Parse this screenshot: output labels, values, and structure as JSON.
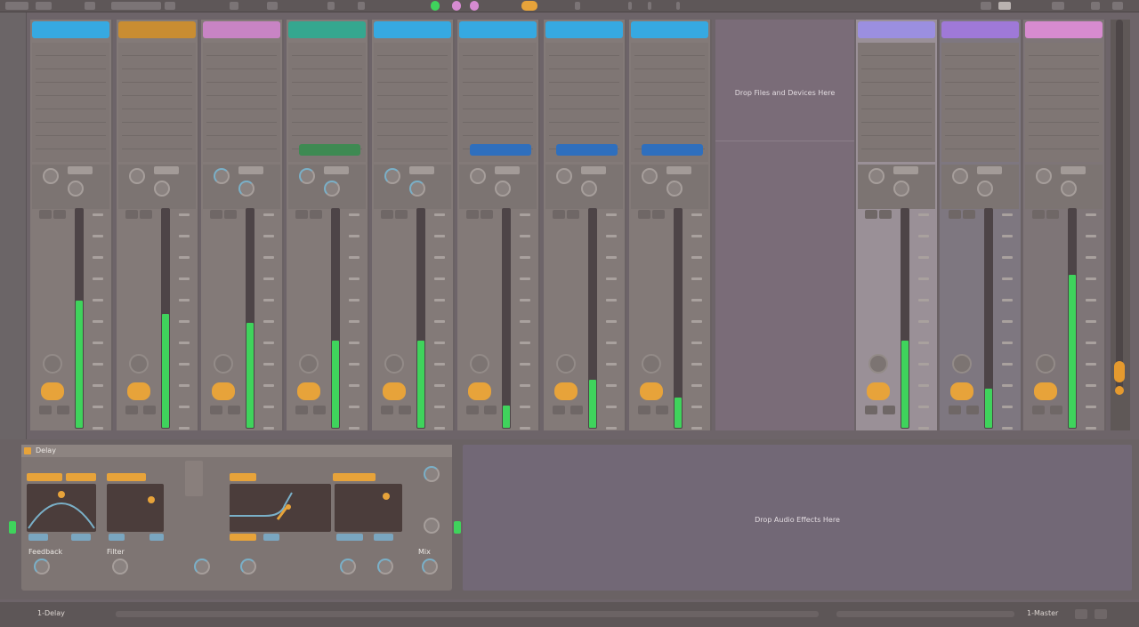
{
  "transport": {
    "record_color": "#3fd35c",
    "accent_color": "#e7a33a",
    "pink_color": "#d68bd1"
  },
  "tracks": [
    {
      "color": "#36a9e1",
      "slot_button_color": "",
      "meter_level": 0.58,
      "pan_arc": false
    },
    {
      "color": "#c98d32",
      "slot_button_color": "",
      "meter_level": 0.52,
      "pan_arc": false
    },
    {
      "color": "#c884c4",
      "slot_button_color": "",
      "meter_level": 0.48,
      "pan_arc": true
    },
    {
      "color": "#35a78f",
      "slot_button_color": "#3e8a52",
      "meter_level": 0.4,
      "pan_arc": true
    },
    {
      "color": "#36a9e1",
      "slot_button_color": "",
      "meter_level": 0.4,
      "pan_arc": true
    },
    {
      "color": "#36a9e1",
      "slot_button_color": "#2f6fbd",
      "meter_level": 0.1,
      "pan_arc": false
    },
    {
      "color": "#36a9e1",
      "slot_button_color": "#2f6fbd",
      "meter_level": 0.22,
      "pan_arc": false
    },
    {
      "color": "#36a9e1",
      "slot_button_color": "#2f6fbd",
      "meter_level": 0.14,
      "pan_arc": false
    }
  ],
  "returns": [
    {
      "color": "#9b8fe0",
      "meter_level": 0.4
    },
    {
      "color": "#9f79d8",
      "meter_level": 0.18
    }
  ],
  "master": {
    "color": "#d78bcf",
    "meter_level": 0.7
  },
  "meter_color": "#3fd35c",
  "drop_zone": {
    "text": "Drop Files and Devices Here"
  },
  "device_panel": {
    "title": "Delay",
    "params": [
      {
        "label": "Feedback"
      },
      {
        "label": "Filter"
      },
      {
        "label": "Mix"
      }
    ]
  },
  "effects_hint": {
    "text": "Drop Audio Effects Here"
  },
  "status": {
    "left": "1-Delay",
    "right": "1-Master"
  }
}
